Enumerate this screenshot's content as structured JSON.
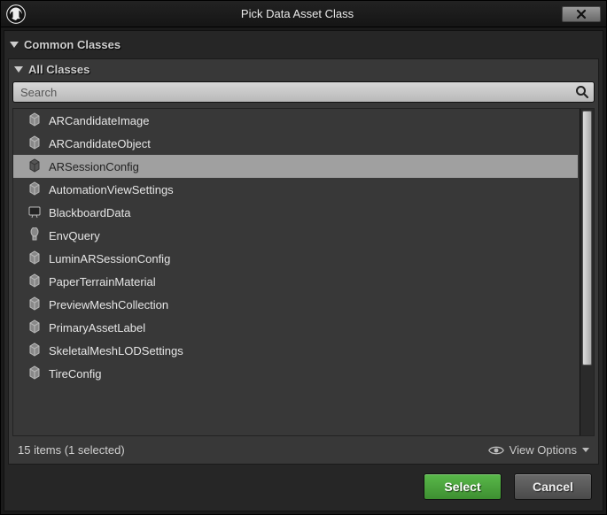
{
  "window": {
    "title": "Pick Data Asset Class"
  },
  "sections": {
    "common": {
      "label": "Common Classes"
    },
    "all": {
      "label": "All Classes"
    }
  },
  "search": {
    "placeholder": "Search",
    "value": ""
  },
  "classes": {
    "items": [
      {
        "label": "ARCandidateImage",
        "icon": "asset",
        "selected": false
      },
      {
        "label": "ARCandidateObject",
        "icon": "asset",
        "selected": false
      },
      {
        "label": "ARSessionConfig",
        "icon": "asset",
        "selected": true
      },
      {
        "label": "AutomationViewSettings",
        "icon": "asset",
        "selected": false
      },
      {
        "label": "BlackboardData",
        "icon": "blackboard",
        "selected": false
      },
      {
        "label": "EnvQuery",
        "icon": "envquery",
        "selected": false
      },
      {
        "label": "LuminARSessionConfig",
        "icon": "asset",
        "selected": false
      },
      {
        "label": "PaperTerrainMaterial",
        "icon": "asset",
        "selected": false
      },
      {
        "label": "PreviewMeshCollection",
        "icon": "asset",
        "selected": false
      },
      {
        "label": "PrimaryAssetLabel",
        "icon": "asset",
        "selected": false
      },
      {
        "label": "SkeletalMeshLODSettings",
        "icon": "asset",
        "selected": false
      },
      {
        "label": "TireConfig",
        "icon": "asset",
        "selected": false
      }
    ]
  },
  "status": {
    "text": "15 items (1 selected)",
    "view_options_label": "View Options"
  },
  "buttons": {
    "select": "Select",
    "cancel": "Cancel"
  },
  "colors": {
    "accent_green": "#4aad3c",
    "panel_bg": "#383838",
    "window_bg": "#262626",
    "selected_bg": "#a0a0a0"
  }
}
